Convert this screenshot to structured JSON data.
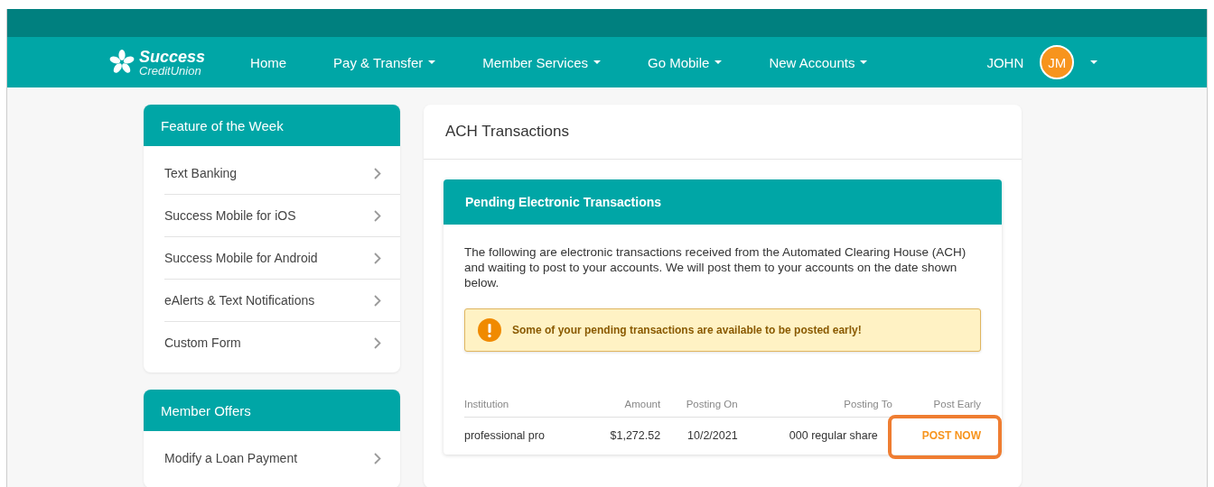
{
  "logo": {
    "name": "Success",
    "subtitle": "CreditUnion"
  },
  "nav": [
    {
      "label": "Home",
      "dropdown": false
    },
    {
      "label": "Pay & Transfer",
      "dropdown": true
    },
    {
      "label": "Member Services",
      "dropdown": true
    },
    {
      "label": "Go Mobile",
      "dropdown": true
    },
    {
      "label": "New Accounts",
      "dropdown": true
    }
  ],
  "user": {
    "name": "JOHN",
    "initials": "JM"
  },
  "sidebar": [
    {
      "title": "Feature of the Week",
      "items": [
        "Text Banking",
        "Success Mobile for iOS",
        "Success Mobile for Android",
        "eAlerts & Text Notifications",
        "Custom Form"
      ]
    },
    {
      "title": "Member Offers",
      "items": [
        "Modify a Loan Payment"
      ]
    }
  ],
  "main": {
    "title": "ACH Transactions",
    "panel": {
      "title": "Pending Electronic Transactions",
      "intro": "The following are electronic transactions received from the Automated Clearing House (ACH) and waiting to post to your accounts. We will post them to your accounts on the date shown below.",
      "alert": "Some of your pending transactions are available to be posted early!",
      "table": {
        "columns": [
          "Institution",
          "Amount",
          "Posting On",
          "Posting To",
          "Post Early"
        ],
        "rows": [
          {
            "institution": "professional pro",
            "amount": "$1,272.52",
            "posting_on": "10/2/2021",
            "posting_to": "000 regular share",
            "action": "POST NOW",
            "highlighted": true
          }
        ]
      }
    }
  }
}
